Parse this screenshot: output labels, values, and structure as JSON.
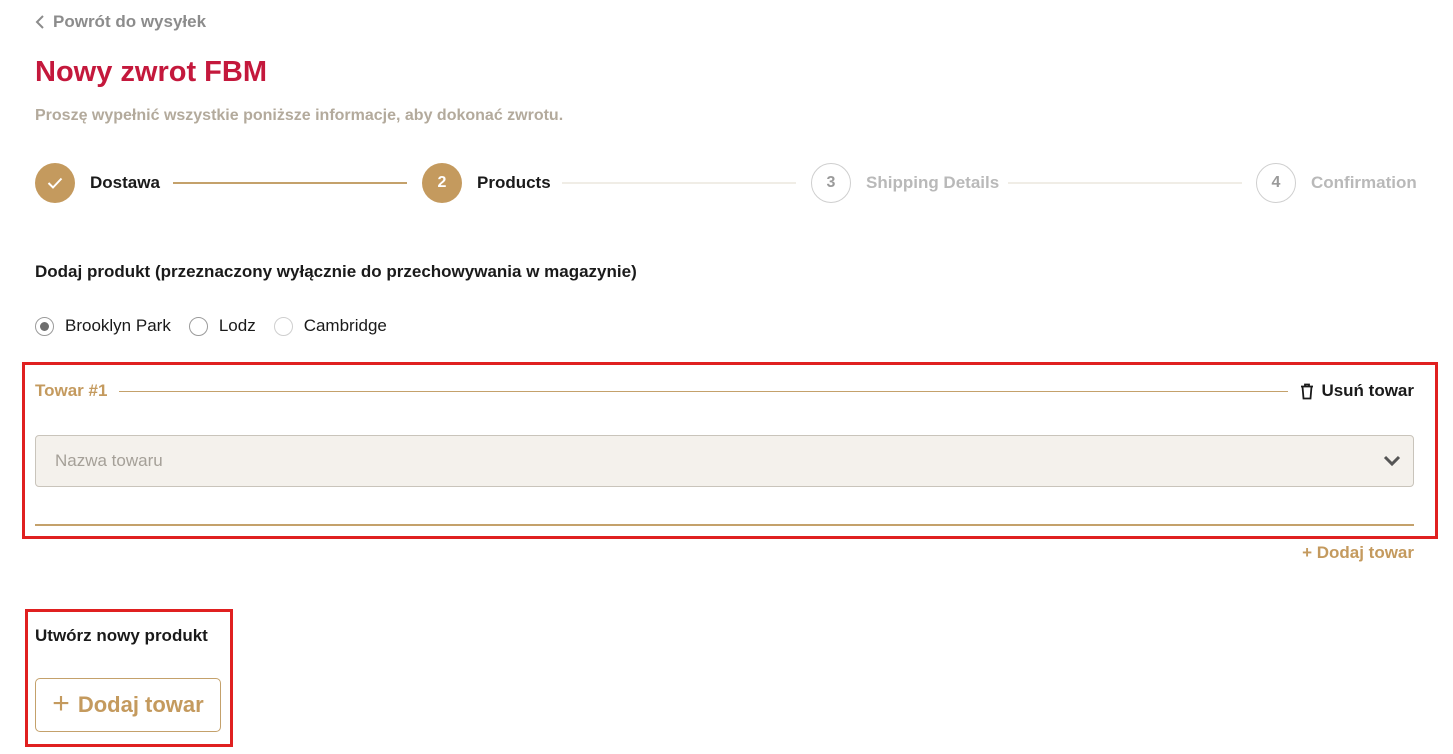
{
  "nav": {
    "back_label": "Powrót do wysyłek"
  },
  "header": {
    "title": "Nowy zwrot FBM",
    "subtitle": "Proszę wypełnić wszystkie poniższe informacje, aby dokonać zwrotu."
  },
  "stepper": {
    "steps": [
      {
        "number": "",
        "label": "Dostawa",
        "state": "done"
      },
      {
        "number": "2",
        "label": "Products",
        "state": "active"
      },
      {
        "number": "3",
        "label": "Shipping Details",
        "state": "pending"
      },
      {
        "number": "4",
        "label": "Confirmation",
        "state": "pending"
      }
    ]
  },
  "product_section": {
    "label": "Dodaj produkt (przeznaczony wyłącznie do przechowywania w magazynie)",
    "warehouses": [
      {
        "label": "Brooklyn Park",
        "checked": true
      },
      {
        "label": "Lodz",
        "checked": false
      },
      {
        "label": "Cambridge",
        "checked": false
      }
    ]
  },
  "item": {
    "title": "Towar #1",
    "remove_label": "Usuń towar",
    "select_placeholder": "Nazwa towaru"
  },
  "add_item_link": "+ Dodaj towar",
  "create_section": {
    "label": "Utwórz nowy produkt",
    "button_label": "Dodaj towar"
  },
  "colors": {
    "brand_red": "#c4183c",
    "accent_gold": "#c49a5e",
    "highlight": "#e02020"
  }
}
